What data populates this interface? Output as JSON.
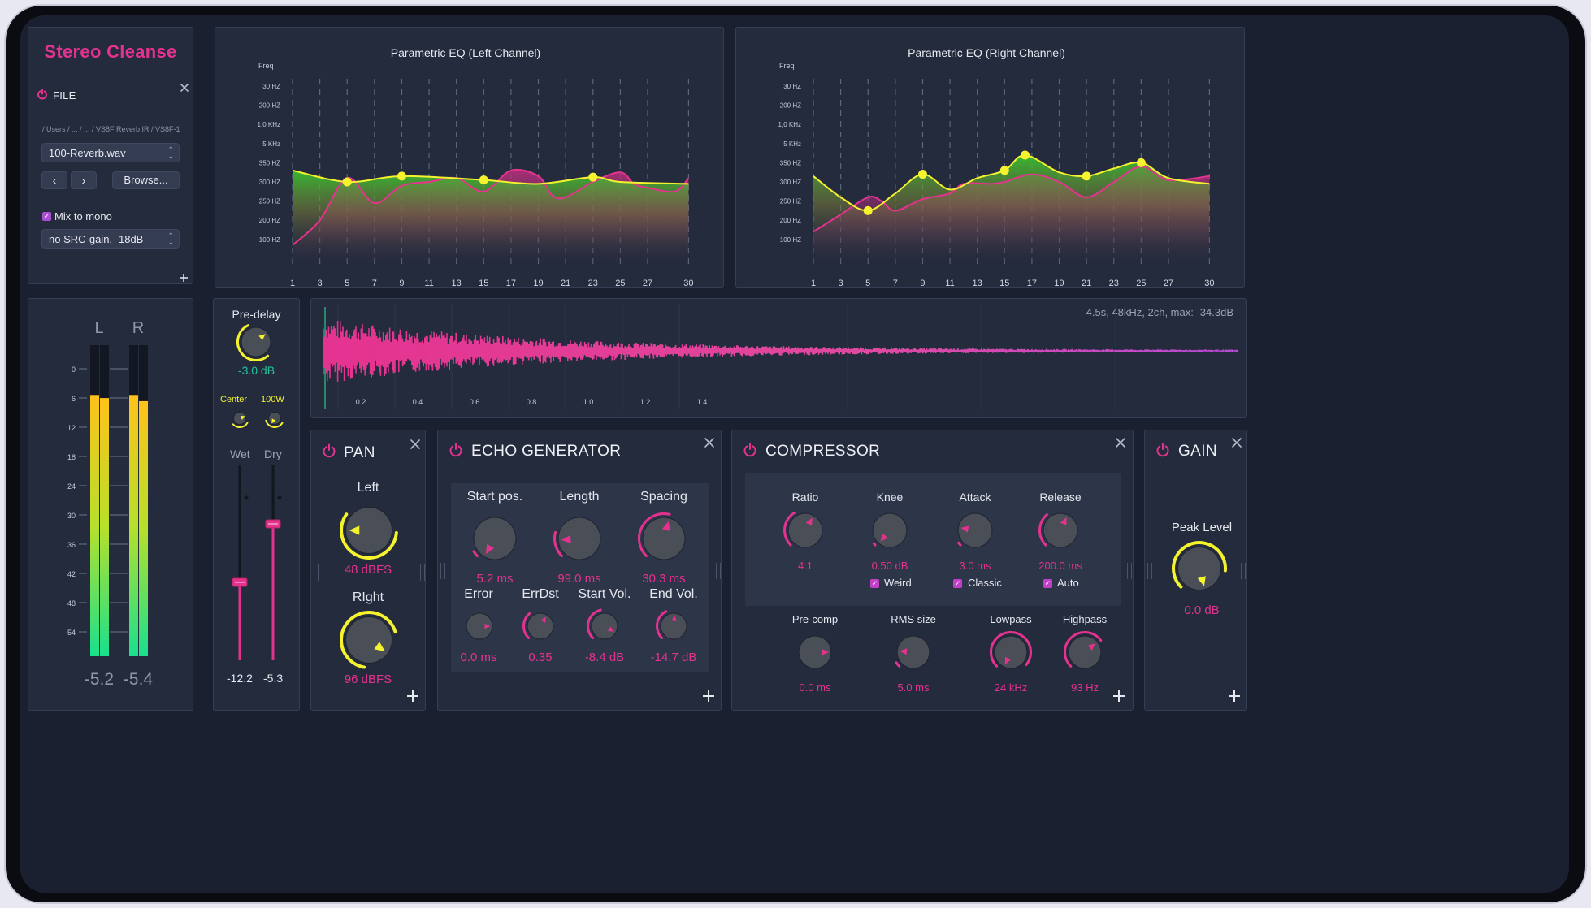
{
  "app": {
    "title": "Stereo Cleanse"
  },
  "file": {
    "title": "FILE",
    "path": "/ Users / ... / ... / VS8F Reverb IR / VS8F-1",
    "selected_file": "100-Reverb.wav",
    "browse_label": "Browse...",
    "mix_to_mono_label": "Mix to mono",
    "mix_to_mono_checked": true,
    "gain_option": "no SRC-gain, -18dB"
  },
  "eq_left": {
    "title": "Parametric EQ (Left Channel)",
    "ylabel": "Freq"
  },
  "eq_right": {
    "title": "Parametric EQ (Right Channel)",
    "ylabel": "Freq"
  },
  "chart_data": [
    {
      "type": "area",
      "title": "Parametric EQ (Left Channel)",
      "ylabel": "Freq",
      "x_ticks": [
        "1",
        "3",
        "5",
        "7",
        "9",
        "11",
        "13",
        "15",
        "17",
        "19",
        "21",
        "23",
        "25",
        "27",
        "30"
      ],
      "y_ticks": [
        "30 HZ",
        "200 HZ",
        "1,0 KHz",
        "5 KHz",
        "350 HZ",
        "300 HZ",
        "250 HZ",
        "200 HZ",
        "100 HZ"
      ],
      "grid": "vertical dashed",
      "series": [
        {
          "color": "#f5f22e",
          "points": [
            [
              1,
              3.6
            ],
            [
              5,
              3.0
            ],
            [
              9,
              3.3
            ],
            [
              15,
              3.1
            ],
            [
              19,
              2.9
            ],
            [
              23,
              3.25
            ],
            [
              25,
              3.0
            ],
            [
              30,
              2.9
            ]
          ],
          "handles": [
            [
              5,
              3.0
            ],
            [
              9,
              3.3
            ],
            [
              15,
              3.1
            ],
            [
              23,
              3.25
            ]
          ]
        },
        {
          "color": "#e8328f",
          "points": [
            [
              1,
              -0.3
            ],
            [
              3,
              1.0
            ],
            [
              5,
              3.2
            ],
            [
              7,
              1.9
            ],
            [
              9,
              2.8
            ],
            [
              11,
              3.0
            ],
            [
              13,
              3.2
            ],
            [
              15,
              2.5
            ],
            [
              17,
              3.6
            ],
            [
              19,
              3.3
            ],
            [
              20,
              2.3
            ],
            [
              21,
              2.2
            ],
            [
              23,
              3.0
            ],
            [
              25,
              3.5
            ],
            [
              26,
              2.9
            ],
            [
              27,
              2.7
            ],
            [
              29,
              2.5
            ],
            [
              30,
              3.2
            ]
          ],
          "handles": []
        }
      ]
    },
    {
      "type": "area",
      "title": "Parametric EQ (Right Channel)",
      "ylabel": "Freq",
      "x_ticks": [
        "1",
        "3",
        "5",
        "7",
        "9",
        "11",
        "13",
        "15",
        "17",
        "19",
        "21",
        "23",
        "25",
        "27",
        "30"
      ],
      "y_ticks": [
        "30 HZ",
        "200 HZ",
        "1,0 KHz",
        "5 KHz",
        "350 HZ",
        "300 HZ",
        "250 HZ",
        "200 HZ",
        "100 HZ"
      ],
      "grid": "vertical dashed",
      "series": [
        {
          "color": "#f5f22e",
          "points": [
            [
              1,
              3.3
            ],
            [
              3,
              2.2
            ],
            [
              5,
              1.5
            ],
            [
              7,
              2.4
            ],
            [
              9,
              3.4
            ],
            [
              11,
              2.6
            ],
            [
              13,
              3.2
            ],
            [
              15,
              3.6
            ],
            [
              16.5,
              4.4
            ],
            [
              19,
              3.5
            ],
            [
              21,
              3.3
            ],
            [
              23,
              3.7
            ],
            [
              25,
              4.0
            ],
            [
              27,
              3.2
            ],
            [
              30,
              2.9
            ]
          ],
          "handles": [
            [
              5,
              1.5
            ],
            [
              9,
              3.4
            ],
            [
              15,
              3.6
            ],
            [
              16.5,
              4.4
            ],
            [
              21,
              3.3
            ],
            [
              25,
              4.0
            ]
          ]
        },
        {
          "color": "#e8328f",
          "points": [
            [
              1,
              0.4
            ],
            [
              3,
              1.3
            ],
            [
              5,
              2.2
            ],
            [
              6,
              2.0
            ],
            [
              7,
              1.5
            ],
            [
              9,
              2.1
            ],
            [
              11,
              2.4
            ],
            [
              12,
              2.9
            ],
            [
              14,
              2.9
            ],
            [
              15,
              3.0
            ],
            [
              17,
              3.4
            ],
            [
              19,
              3.0
            ],
            [
              21,
              2.2
            ],
            [
              23,
              3.0
            ],
            [
              25,
              3.8
            ],
            [
              27,
              3.1
            ],
            [
              30,
              3.3
            ]
          ],
          "handles": []
        }
      ]
    }
  ],
  "meters": {
    "labels": [
      "L",
      "R"
    ],
    "scale": [
      "0",
      "6",
      "12",
      "18",
      "24",
      "30",
      "36",
      "42",
      "48",
      "54"
    ],
    "readouts": [
      "-5.2",
      "-5.4"
    ],
    "levels": [
      0.84,
      0.83,
      0.84,
      0.82
    ]
  },
  "reverb": {
    "predelay_label": "Pre-delay",
    "predelay_value": "-3.0 dB",
    "center_label": "Center",
    "w_label": "100W",
    "wet_label": "Wet",
    "dry_label": "Dry",
    "wet_value": "-12.2",
    "dry_value": "-5.3",
    "wet_level": 0.4,
    "dry_level": 0.7
  },
  "waveform": {
    "info": "4.5s, 48kHz, 2ch, max: -34.3dB",
    "ticks": [
      "0.2",
      "0.4",
      "0.6",
      "0.8",
      "1.0",
      "1.2",
      "1.4"
    ]
  },
  "pan": {
    "title": "PAN",
    "left_label": "Left",
    "left_value": "48 dBFS",
    "right_label": "RIght",
    "right_value": "96 dBFS"
  },
  "echo": {
    "title": "ECHO GENERATOR",
    "knobs": [
      {
        "label": "Start pos.",
        "value": "5.2 ms"
      },
      {
        "label": "Length",
        "value": "99.0 ms"
      },
      {
        "label": "Spacing",
        "value": "30.3 ms"
      },
      {
        "label": "Error",
        "value": "0.0 ms"
      },
      {
        "label": "ErrDst",
        "value": "0.35"
      },
      {
        "label": "Start Vol.",
        "value": "-8.4 dB"
      },
      {
        "label": "End Vol.",
        "value": "-14.7 dB"
      }
    ]
  },
  "compressor": {
    "title": "COMPRESSOR",
    "knobs": [
      {
        "label": "Ratio",
        "value": "4:1"
      },
      {
        "label": "Knee",
        "value": "0.50 dB"
      },
      {
        "label": "Attack",
        "value": "3.0 ms"
      },
      {
        "label": "Release",
        "value": "200.0 ms"
      },
      {
        "label": "Pre-comp",
        "value": "0.0 ms"
      },
      {
        "label": "RMS size",
        "value": "5.0 ms"
      },
      {
        "label": "Lowpass",
        "value": "24 kHz"
      },
      {
        "label": "Highpass",
        "value": "93 Hz"
      }
    ],
    "checks": [
      {
        "label": "Weird",
        "checked": true
      },
      {
        "label": "Classic",
        "checked": true
      },
      {
        "label": "Auto",
        "checked": true
      }
    ]
  },
  "gain": {
    "title": "GAIN",
    "label": "Peak Level",
    "value": "0.0 dB"
  },
  "colors": {
    "accent": "#e4328f",
    "yellow": "#f5f22e",
    "panel": "#242b3d",
    "bg": "#1b2030"
  }
}
